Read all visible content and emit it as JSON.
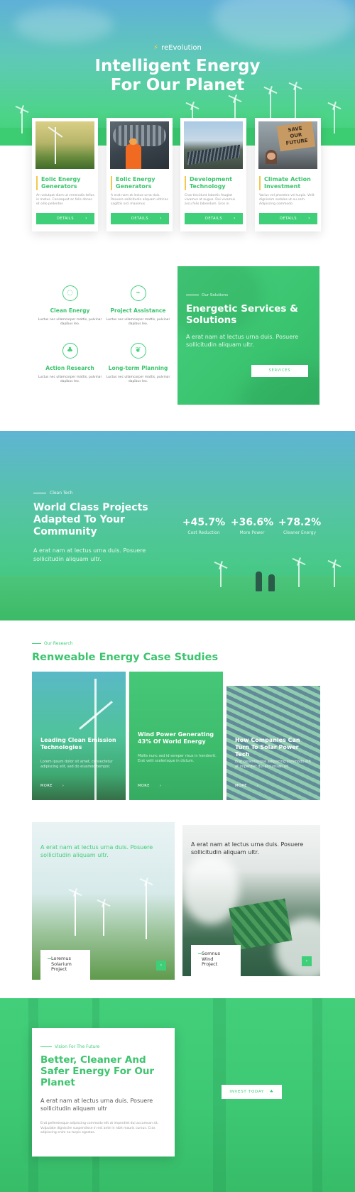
{
  "brand": {
    "name": "reEvolution",
    "icon": "bolt-icon"
  },
  "hero": {
    "title_line1": "Intelligent Energy",
    "title_line2": "For Our Planet"
  },
  "cards": [
    {
      "title": "Eolic Energy Generators",
      "text": "An volutpat diam ut venenatis tellus in metus. Consequat ac felis donec et odio pellentes",
      "button": "DETAILS"
    },
    {
      "title": "Eolic Energy Generators",
      "text": "A erat nam at lectus urna duis. Posuere sollicitudin aliquam ultrices sagittis orci maximus.",
      "button": "DETAILS"
    },
    {
      "title": "Development Technology",
      "text": "Cras tincidunt lobortis feugiat vivamus at augue. Dui vivamus arcu felis bibendum. Eros in",
      "button": "DETAILS"
    },
    {
      "title": "Climate Action Investment",
      "text": "Varius vel pharetra vel turpis. Velit dignissim sodales ut eu sem. Adipiscing commodo.",
      "button": "DETAILS"
    }
  ],
  "services": [
    {
      "icon": "lightbulb-icon",
      "title": "Clean Energy",
      "text": "Luctus nec ullamcorper mattis, pulvinar dapibus leo."
    },
    {
      "icon": "chart-icon",
      "title": "Project Assistance",
      "text": "Luctus nec ullamcorper mattis, pulvinar dapibus leo."
    },
    {
      "icon": "tree-icon",
      "title": "Action Research",
      "text": "Luctus nec ullamcorper mattis, pulvinar dapibus leo."
    },
    {
      "icon": "leaf-icon",
      "title": "Long-term Planning",
      "text": "Luctus nec ullamcorper mattis, pulvinar dapibus leo."
    }
  ],
  "solutions": {
    "subtitle": "Our Solutions",
    "title": "Energetic Services & Solutions",
    "text": "A erat nam at lectus urna duis. Posuere sollicitudin aliquam ultr.",
    "button": "SERVICES"
  },
  "projects": {
    "subtitle": "Clean Tech",
    "title": "World Class Projects Adapted To Your Community",
    "text": "A erat nam at lectus urna duis. Posuere sollicitudin aliquam ultr.",
    "stats": [
      {
        "value": "+45.7%",
        "label": "Cost Reduction"
      },
      {
        "value": "+36.6%",
        "label": "More Power"
      },
      {
        "value": "+78.2%",
        "label": "Cleaner Energy"
      }
    ]
  },
  "research": {
    "subtitle": "Our Research",
    "title": "Renweable Energy Case Studies",
    "cases": [
      {
        "title": "Leading Clean Emission Technologies",
        "text": "Lorem ipsum dolor sit amet, consectetur adipiscing elit, sed do eiusmod tempor.",
        "link": "MORE"
      },
      {
        "title": "Wind Power Generating 43% Of World Energy",
        "text": "Mollis nunc sed id semper risus in hendrerit. Erat velit scelerisque in dictum.",
        "link": "MORE"
      },
      {
        "title": "How Companies Can Turn To Solar Power Tech",
        "text": "Erat pellentesque adipiscing commodo elit at imperdiet dui accumsan sit.",
        "link": "MORE"
      }
    ]
  },
  "featured": [
    {
      "quote": "A erat nam at lectus urna duis. Posuere sollicitudin aliquam ultr.",
      "label": [
        "Loremus",
        "Solarium",
        "Project"
      ]
    },
    {
      "quote": "A erat nam at lectus urna duis. Posuere sollicitudin aliquam ultr.",
      "label": [
        "Somnus",
        "Wind",
        "Project"
      ]
    }
  ],
  "footer": {
    "subtitle": "Vision For The Future",
    "title": "Better, Cleaner And Safer Energy For Our Planet",
    "text": "A erat nam at lectus urna duis. Posuere sollicitudin aliquam ultr",
    "small": "Erat pellentesque adipiscing commodo elit at imperdiet dui accumsan sit. Vulputate dignissim suspendisse in est ante in nibh mauris cursus. Cras adipiscing enim eu turpis egestas.",
    "button": "INVEST TODAY"
  },
  "colors": {
    "accent": "#3ecf78",
    "title_green": "#3dc46e",
    "yellow": "#f2c94c"
  }
}
